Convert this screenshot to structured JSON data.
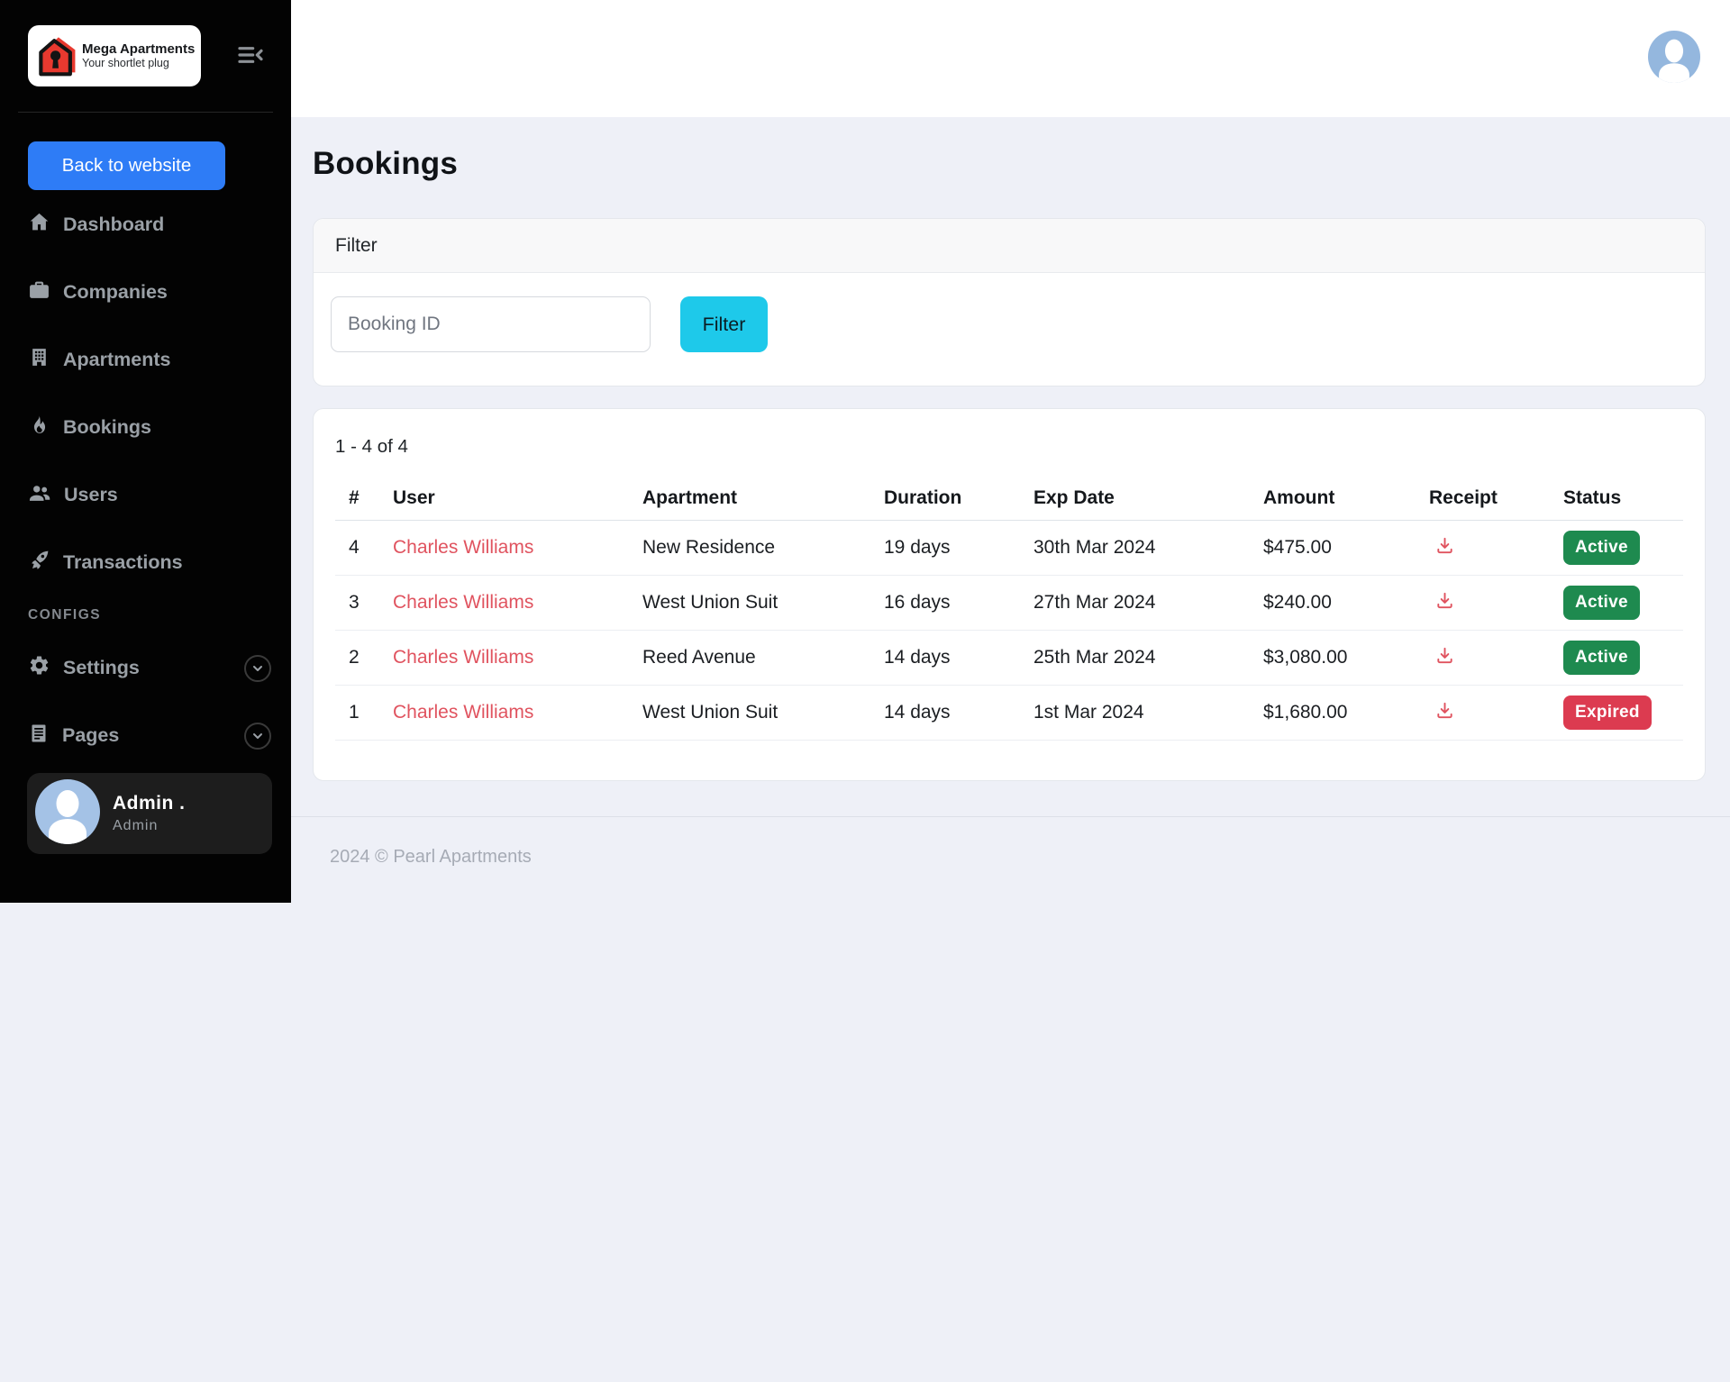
{
  "brand": {
    "name": "Mega Apartments",
    "tagline": "Your shortlet plug"
  },
  "sidebar": {
    "back_button_label": "Back to website",
    "items": [
      {
        "label": "Dashboard",
        "icon": "home-icon"
      },
      {
        "label": "Companies",
        "icon": "briefcase-icon"
      },
      {
        "label": "Apartments",
        "icon": "building-icon"
      },
      {
        "label": "Bookings",
        "icon": "flame-icon"
      },
      {
        "label": "Users",
        "icon": "users-icon"
      },
      {
        "label": "Transactions",
        "icon": "rocket-icon"
      }
    ],
    "configs_label": "CONFIGS",
    "config_items": [
      {
        "label": "Settings",
        "icon": "gear-icon",
        "expandable": true
      },
      {
        "label": "Pages",
        "icon": "document-icon",
        "expandable": true
      }
    ],
    "profile": {
      "name": "Admin .",
      "role": "Admin"
    }
  },
  "page": {
    "title": "Bookings"
  },
  "filter": {
    "header": "Filter",
    "input_placeholder": "Booking ID",
    "input_value": "",
    "button_label": "Filter"
  },
  "table": {
    "count": "1 - 4 of 4",
    "headers": [
      "#",
      "User",
      "Apartment",
      "Duration",
      "Exp Date",
      "Amount",
      "Receipt",
      "Status"
    ],
    "rows": [
      {
        "num": "4",
        "user": "Charles Williams",
        "apartment": "New Residence",
        "duration": "19 days",
        "exp": "30th Mar 2024",
        "amount": "$475.00",
        "status": "Active"
      },
      {
        "num": "3",
        "user": "Charles Williams",
        "apartment": "West Union Suit",
        "duration": "16 days",
        "exp": "27th Mar 2024",
        "amount": "$240.00",
        "status": "Active"
      },
      {
        "num": "2",
        "user": "Charles Williams",
        "apartment": "Reed Avenue",
        "duration": "14 days",
        "exp": "25th Mar 2024",
        "amount": "$3,080.00",
        "status": "Active"
      },
      {
        "num": "1",
        "user": "Charles Williams",
        "apartment": "West Union Suit",
        "duration": "14 days",
        "exp": "1st Mar 2024",
        "amount": "$1,680.00",
        "status": "Expired"
      }
    ]
  },
  "footer": {
    "copyright": "2024 © Pearl Apartments"
  },
  "colors": {
    "sidebar_bg": "#030303",
    "main_bg": "#eef0f7",
    "accent_blue": "#2e7cf6",
    "accent_cyan": "#1ec9ea",
    "link_red": "#e0535f",
    "status_active_green": "#1e8a4f",
    "status_expired_red": "#dc3b50",
    "logo_red": "#e8392f"
  }
}
